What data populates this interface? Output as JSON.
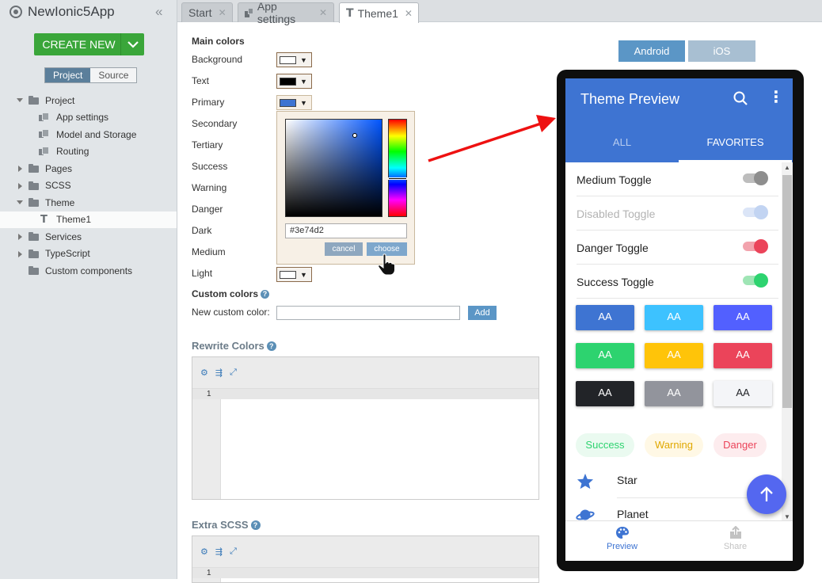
{
  "app": {
    "name": "NewIonic5App"
  },
  "sidebar": {
    "create_label": "CREATE NEW",
    "segment": {
      "project": "Project",
      "source": "Source"
    },
    "tree": [
      {
        "label": "Project",
        "type": "folder",
        "expanded": true,
        "level": 0
      },
      {
        "label": "App settings",
        "type": "file",
        "level": 1
      },
      {
        "label": "Model and Storage",
        "type": "file",
        "level": 1
      },
      {
        "label": "Routing",
        "type": "file",
        "level": 1
      },
      {
        "label": "Pages",
        "type": "folder",
        "expanded": false,
        "level": 0
      },
      {
        "label": "SCSS",
        "type": "folder",
        "expanded": false,
        "level": 0
      },
      {
        "label": "Theme",
        "type": "folder",
        "expanded": true,
        "level": 0
      },
      {
        "label": "Theme1",
        "type": "theme",
        "level": 1,
        "selected": true
      },
      {
        "label": "Services",
        "type": "folder",
        "expanded": false,
        "level": 0
      },
      {
        "label": "TypeScript",
        "type": "folder",
        "expanded": false,
        "level": 0
      },
      {
        "label": "Custom components",
        "type": "folder",
        "expanded": null,
        "level": 0
      }
    ]
  },
  "tabs": [
    {
      "label": "Start"
    },
    {
      "label": "App settings"
    },
    {
      "label": "Theme1",
      "active": true
    }
  ],
  "settings": {
    "main_colors_title": "Main colors",
    "colors": [
      {
        "label": "Background",
        "swatch": "#ffffff",
        "picker": true
      },
      {
        "label": "Text",
        "swatch": "#000000",
        "picker": true
      },
      {
        "label": "Primary",
        "swatch": "#3e74d2",
        "picker": true
      },
      {
        "label": "Secondary"
      },
      {
        "label": "Tertiary"
      },
      {
        "label": "Success"
      },
      {
        "label": "Warning"
      },
      {
        "label": "Danger"
      },
      {
        "label": "Dark"
      },
      {
        "label": "Medium"
      },
      {
        "label": "Light",
        "swatch": "#ffffff",
        "picker": true
      }
    ],
    "custom_colors_title": "Custom colors",
    "new_custom_color_label": "New custom color:",
    "add_label": "Add",
    "rewrite_title": "Rewrite Colors",
    "extra_title": "Extra SCSS",
    "line_number": "1"
  },
  "picker": {
    "hex": "#3e74d2",
    "cancel": "cancel",
    "choose": "choose"
  },
  "platforms": {
    "android": "Android",
    "ios": "iOS"
  },
  "preview": {
    "title": "Theme Preview",
    "tabs": {
      "all": "ALL",
      "favorites": "FAVORITES"
    },
    "toggles": [
      {
        "label": "Medium Toggle",
        "track": "#bdbdbd",
        "knob": "#8e8e8e",
        "disabled": false
      },
      {
        "label": "Disabled Toggle",
        "track": "#dbe5f7",
        "knob": "#c2d4f2",
        "disabled": true
      },
      {
        "label": "Danger Toggle",
        "track": "#f2a3ad",
        "knob": "#eb445a",
        "disabled": false
      },
      {
        "label": "Success Toggle",
        "track": "#9fe5b5",
        "knob": "#2dd36f",
        "disabled": false
      }
    ],
    "buttons": [
      {
        "label": "AA",
        "bg": "#3e74d2",
        "fg": "#ffffff"
      },
      {
        "label": "AA",
        "bg": "#3dc2ff",
        "fg": "#ffffff"
      },
      {
        "label": "AA",
        "bg": "#5260ff",
        "fg": "#ffffff"
      },
      {
        "label": "AA",
        "bg": "#2dd36f",
        "fg": "#ffffff"
      },
      {
        "label": "AA",
        "bg": "#ffc409",
        "fg": "#ffffff"
      },
      {
        "label": "AA",
        "bg": "#eb445a",
        "fg": "#ffffff"
      },
      {
        "label": "AA",
        "bg": "#222428",
        "fg": "#ffffff"
      },
      {
        "label": "AA",
        "bg": "#92949c",
        "fg": "#ffffff"
      },
      {
        "label": "AA",
        "bg": "#f4f5f8",
        "fg": "#222428"
      }
    ],
    "chips": [
      {
        "label": "Success",
        "bg": "#eafaf0",
        "fg": "#2dd36f"
      },
      {
        "label": "Warning",
        "bg": "#fff8e5",
        "fg": "#e0a800"
      },
      {
        "label": "Danger",
        "bg": "#fdecee",
        "fg": "#eb445a"
      }
    ],
    "items": [
      {
        "label": "Star",
        "icon": "star-icon"
      },
      {
        "label": "Planet",
        "icon": "planet-icon"
      }
    ],
    "bottom_nav": {
      "preview": "Preview",
      "share": "Share"
    }
  }
}
